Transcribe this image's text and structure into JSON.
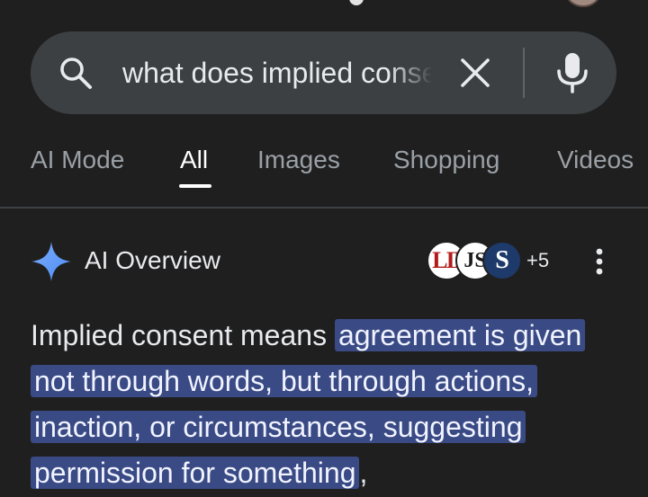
{
  "search": {
    "query": "what does implied consent mean",
    "clear_icon": "close-icon",
    "voice_icon": "mic-icon"
  },
  "tabs": [
    {
      "label": "AI Mode",
      "active": false
    },
    {
      "label": "All",
      "active": true
    },
    {
      "label": "Images",
      "active": false
    },
    {
      "label": "Shopping",
      "active": false
    },
    {
      "label": "Videos",
      "active": false
    }
  ],
  "ai_overview": {
    "title": "AI Overview",
    "sources": [
      {
        "logo_text": "LII"
      },
      {
        "logo_text": "JS"
      },
      {
        "logo_text": "S"
      }
    ],
    "more_sources": "+5",
    "answer": {
      "lead": "Implied consent means ",
      "highlight": "agreement is given not through words, but through actions, inaction, or circumstances, suggesting permission for something",
      "trail": ","
    }
  },
  "colors": {
    "background": "#1f1f1f",
    "search_bar": "#3c4043",
    "highlight": "#394a84",
    "sparkle": "#4c8df6"
  }
}
